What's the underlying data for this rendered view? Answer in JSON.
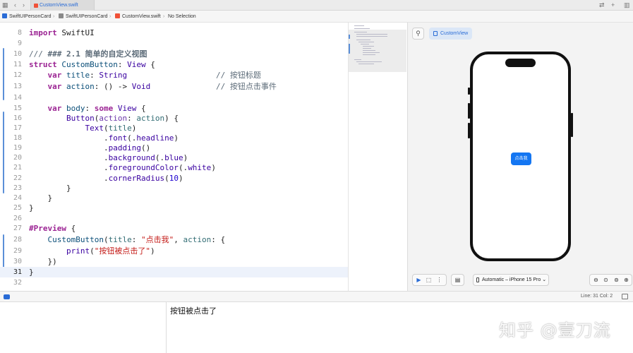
{
  "tab": {
    "label": "CustomView.swift"
  },
  "breadcrumb": {
    "project": "SwiftUIPersonCard",
    "folder": "SwiftUIPersonCard",
    "file": "CustomView.swift",
    "symbol": "No Selection"
  },
  "editor": {
    "lines": [
      {
        "n": "8"
      },
      {
        "n": "9"
      },
      {
        "n": "10"
      },
      {
        "n": "11"
      },
      {
        "n": "12"
      },
      {
        "n": "13"
      },
      {
        "n": "14"
      },
      {
        "n": "15"
      },
      {
        "n": "16"
      },
      {
        "n": "17"
      },
      {
        "n": "18"
      },
      {
        "n": "19"
      },
      {
        "n": "20"
      },
      {
        "n": "21"
      },
      {
        "n": "22"
      },
      {
        "n": "23"
      },
      {
        "n": "24"
      },
      {
        "n": "25"
      },
      {
        "n": "26"
      },
      {
        "n": "27"
      },
      {
        "n": "28"
      },
      {
        "n": "29"
      },
      {
        "n": "30"
      },
      {
        "n": "31"
      },
      {
        "n": "32"
      }
    ],
    "current_line": "31",
    "code": {
      "l8": [
        "import",
        " SwiftUI"
      ],
      "l10": [
        "/// ",
        "### 2.1 简单的自定义视图"
      ],
      "l11": [
        "struct",
        " ",
        "CustomButton",
        ": ",
        "View",
        " {"
      ],
      "l12": [
        "    ",
        "var",
        " ",
        "title",
        ": ",
        "String",
        "                   ",
        "// 按钮标题"
      ],
      "l13": [
        "    ",
        "var",
        " ",
        "action",
        ": () -> ",
        "Void",
        "              ",
        "// 按钮点击事件"
      ],
      "l15": [
        "    ",
        "var",
        " ",
        "body",
        ": ",
        "some",
        " ",
        "View",
        " {"
      ],
      "l16": [
        "        ",
        "Button",
        "(",
        "action",
        ": ",
        "action",
        ") {"
      ],
      "l17": [
        "            ",
        "Text",
        "(",
        "title",
        ")"
      ],
      "l18": [
        "                .",
        "font",
        "(.",
        "headline",
        ")"
      ],
      "l19": [
        "                .",
        "padding",
        "()"
      ],
      "l20": [
        "                .",
        "background",
        "(.",
        "blue",
        ")"
      ],
      "l21": [
        "                .",
        "foregroundColor",
        "(.",
        "white",
        ")"
      ],
      "l22": [
        "                .",
        "cornerRadius",
        "(",
        "10",
        ")"
      ],
      "l23": [
        "        }"
      ],
      "l24": [
        "    }"
      ],
      "l25": [
        "}"
      ],
      "l27": [
        "#Preview",
        " {"
      ],
      "l28": [
        "    ",
        "CustomButton",
        "(",
        "title",
        ": ",
        "\"点击我\"",
        ", ",
        "action",
        ": {"
      ],
      "l29": [
        "        ",
        "print",
        "(",
        "\"按钮被点击了\"",
        ")"
      ],
      "l30": [
        "    })"
      ],
      "l31": [
        "}"
      ]
    }
  },
  "preview": {
    "tab_label": "CustomView",
    "button_label": "点击我",
    "device": "Automatic – iPhone 15 Pro"
  },
  "status": {
    "position": "Line: 31  Col: 2"
  },
  "console": {
    "output": "按钮被点击了",
    "watermark": "知乎 @壹刀流"
  },
  "colors": {
    "accent": "#2a6cd6",
    "button_blue": "#1476f2"
  }
}
